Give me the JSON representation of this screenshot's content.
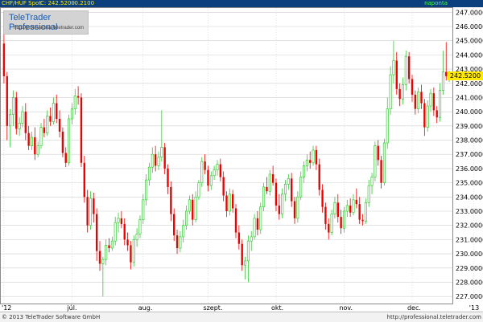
{
  "header": {
    "symbol": "CHF/HUF Spot",
    "price": "C: 242.5200",
    "change": "-0.2100",
    "period": "naponta"
  },
  "logo": {
    "title": "TeleTrader Professional",
    "url": "http://professional.teletrader.com"
  },
  "footer": {
    "copyright": "© 2013 TeleTrader Software GmbH",
    "url": "http://professional.teletrader.com"
  },
  "colors": {
    "up": "#33cc33",
    "down": "#ee0000",
    "grid": "#cfcfcf",
    "header_bg": "#0b3f7d"
  },
  "last_price_label": "242.5200",
  "chart_data": {
    "type": "candlestick",
    "ylim": [
      226.5,
      247.3
    ],
    "y_ticks": [
      "227.0000",
      "228.0000",
      "229.0000",
      "230.0000",
      "231.0000",
      "232.0000",
      "233.0000",
      "234.0000",
      "235.0000",
      "236.0000",
      "237.0000",
      "238.0000",
      "239.0000",
      "240.0000",
      "241.0000",
      "242.0000",
      "243.0000",
      "244.0000",
      "245.0000",
      "246.0000",
      "247.0000"
    ],
    "x_tick_labels": [
      "'12",
      "júl.",
      "aug.",
      "szept.",
      "okt.",
      "nov.",
      "dec.",
      "'13"
    ],
    "x_tick_index": [
      0,
      22,
      45,
      66,
      88,
      110,
      132,
      152
    ],
    "grid": true,
    "candles": [
      [
        244.8,
        246.0,
        242.0,
        242.5
      ],
      [
        242.5,
        242.8,
        238.0,
        239.0
      ],
      [
        239.0,
        240.2,
        237.5,
        239.8
      ],
      [
        239.8,
        241.5,
        239.0,
        241.0
      ],
      [
        241.0,
        241.4,
        238.4,
        238.8
      ],
      [
        238.8,
        239.6,
        238.3,
        239.2
      ],
      [
        239.2,
        240.4,
        238.9,
        240.0
      ],
      [
        240.0,
        240.6,
        238.0,
        238.5
      ],
      [
        238.5,
        239.0,
        237.3,
        237.6
      ],
      [
        237.6,
        238.6,
        237.3,
        238.2
      ],
      [
        238.2,
        238.9,
        236.6,
        237.0
      ],
      [
        237.0,
        237.9,
        236.8,
        237.6
      ],
      [
        237.6,
        239.2,
        237.4,
        238.9
      ],
      [
        238.9,
        239.5,
        238.2,
        238.5
      ],
      [
        238.5,
        240.1,
        238.3,
        239.7
      ],
      [
        239.7,
        240.3,
        239.0,
        239.3
      ],
      [
        239.3,
        241.0,
        239.1,
        240.6
      ],
      [
        240.6,
        241.2,
        239.2,
        239.5
      ],
      [
        239.5,
        240.1,
        238.2,
        238.6
      ],
      [
        238.6,
        238.9,
        236.8,
        237.1
      ],
      [
        237.1,
        237.5,
        236.1,
        236.4
      ],
      [
        236.4,
        239.8,
        236.2,
        239.5
      ],
      [
        239.5,
        240.6,
        239.1,
        240.2
      ],
      [
        240.2,
        241.6,
        239.8,
        241.1
      ],
      [
        241.1,
        241.8,
        240.5,
        241.0
      ],
      [
        241.0,
        241.3,
        236.1,
        236.4
      ],
      [
        236.4,
        236.9,
        233.6,
        234.0
      ],
      [
        234.0,
        234.5,
        231.5,
        232.0
      ],
      [
        232.0,
        234.4,
        231.7,
        233.9
      ],
      [
        233.9,
        234.3,
        232.2,
        232.8
      ],
      [
        232.8,
        233.2,
        229.5,
        230.2
      ],
      [
        230.2,
        230.9,
        228.8,
        229.3
      ],
      [
        229.3,
        229.8,
        227.0,
        229.6
      ],
      [
        229.6,
        231.0,
        229.2,
        230.6
      ],
      [
        230.6,
        231.1,
        230.1,
        230.4
      ],
      [
        230.4,
        231.2,
        230.2,
        230.9
      ],
      [
        230.9,
        232.6,
        230.6,
        232.2
      ],
      [
        232.2,
        232.9,
        231.5,
        232.5
      ],
      [
        232.5,
        233.0,
        231.8,
        232.1
      ],
      [
        232.1,
        232.5,
        230.6,
        231.0
      ],
      [
        231.0,
        231.5,
        230.2,
        230.6
      ],
      [
        230.6,
        230.9,
        228.9,
        229.4
      ],
      [
        229.4,
        231.3,
        229.1,
        231.0
      ],
      [
        231.0,
        231.8,
        230.5,
        231.4
      ],
      [
        231.4,
        232.7,
        231.1,
        232.4
      ],
      [
        232.4,
        234.2,
        232.1,
        233.8
      ],
      [
        233.8,
        235.6,
        233.4,
        235.2
      ],
      [
        235.2,
        236.4,
        234.8,
        236.1
      ],
      [
        236.1,
        237.5,
        235.7,
        237.0
      ],
      [
        237.0,
        237.6,
        235.8,
        236.2
      ],
      [
        236.2,
        237.2,
        235.9,
        236.8
      ],
      [
        236.8,
        240.1,
        236.5,
        237.5
      ],
      [
        237.5,
        237.8,
        235.6,
        236.0
      ],
      [
        236.0,
        236.3,
        234.2,
        234.7
      ],
      [
        234.7,
        235.1,
        232.3,
        232.8
      ],
      [
        232.8,
        233.2,
        230.9,
        231.3
      ],
      [
        231.3,
        231.7,
        230.0,
        230.4
      ],
      [
        230.4,
        231.6,
        230.1,
        231.2
      ],
      [
        231.2,
        232.4,
        230.8,
        232.0
      ],
      [
        232.0,
        233.4,
        231.7,
        233.0
      ],
      [
        233.0,
        234.1,
        232.8,
        233.8
      ],
      [
        233.8,
        234.2,
        232.0,
        232.4
      ],
      [
        232.4,
        234.4,
        232.2,
        234.0
      ],
      [
        234.0,
        235.2,
        233.8,
        235.0
      ],
      [
        235.0,
        236.8,
        234.7,
        236.5
      ],
      [
        236.5,
        237.0,
        235.6,
        235.9
      ],
      [
        235.9,
        236.2,
        234.4,
        234.8
      ],
      [
        234.8,
        235.8,
        234.5,
        235.5
      ],
      [
        235.5,
        236.2,
        235.2,
        235.9
      ],
      [
        235.9,
        236.6,
        235.5,
        236.3
      ],
      [
        236.3,
        236.7,
        235.1,
        235.4
      ],
      [
        235.4,
        235.8,
        233.7,
        234.1
      ],
      [
        234.1,
        234.4,
        232.6,
        233.0
      ],
      [
        233.0,
        234.6,
        232.7,
        234.2
      ],
      [
        234.2,
        234.5,
        232.9,
        233.2
      ],
      [
        233.2,
        233.5,
        231.1,
        231.5
      ],
      [
        231.5,
        232.0,
        230.3,
        230.7
      ],
      [
        230.7,
        231.0,
        228.8,
        229.2
      ],
      [
        229.2,
        229.8,
        228.2,
        229.5
      ],
      [
        229.5,
        231.3,
        228.0,
        230.9
      ],
      [
        230.9,
        231.6,
        230.2,
        231.2
      ],
      [
        231.2,
        232.8,
        231.0,
        232.5
      ],
      [
        232.5,
        233.0,
        231.3,
        231.7
      ],
      [
        231.7,
        233.6,
        231.4,
        233.3
      ],
      [
        233.3,
        235.0,
        233.0,
        234.7
      ],
      [
        234.7,
        235.4,
        234.2,
        234.4
      ],
      [
        234.4,
        235.9,
        234.1,
        235.6
      ],
      [
        235.6,
        236.2,
        234.8,
        235.0
      ],
      [
        235.0,
        235.3,
        233.0,
        233.4
      ],
      [
        233.4,
        234.2,
        232.4,
        232.8
      ],
      [
        232.8,
        234.6,
        232.5,
        234.2
      ],
      [
        234.2,
        235.2,
        233.7,
        234.9
      ],
      [
        234.9,
        235.6,
        234.5,
        235.3
      ],
      [
        235.3,
        235.7,
        233.3,
        233.7
      ],
      [
        233.7,
        234.0,
        232.1,
        232.5
      ],
      [
        232.5,
        234.4,
        232.2,
        234.0
      ],
      [
        234.0,
        235.8,
        233.8,
        235.4
      ],
      [
        235.4,
        236.5,
        235.0,
        236.2
      ],
      [
        236.2,
        237.0,
        235.8,
        236.6
      ],
      [
        236.6,
        237.2,
        236.0,
        236.4
      ],
      [
        236.4,
        237.6,
        236.2,
        237.3
      ],
      [
        237.3,
        237.6,
        235.9,
        236.3
      ],
      [
        236.3,
        236.7,
        234.1,
        234.5
      ],
      [
        234.5,
        234.9,
        232.9,
        233.3
      ],
      [
        233.3,
        233.6,
        231.7,
        232.1
      ],
      [
        232.1,
        232.5,
        231.0,
        231.5
      ],
      [
        231.5,
        233.1,
        231.3,
        232.8
      ],
      [
        232.8,
        234.0,
        232.5,
        233.6
      ],
      [
        233.6,
        234.2,
        232.2,
        232.6
      ],
      [
        232.6,
        233.1,
        231.4,
        231.8
      ],
      [
        231.8,
        233.3,
        231.5,
        233.0
      ],
      [
        233.0,
        233.8,
        232.6,
        233.4
      ],
      [
        233.4,
        233.9,
        232.6,
        232.9
      ],
      [
        232.9,
        234.2,
        232.7,
        233.8
      ],
      [
        233.8,
        234.6,
        233.2,
        233.5
      ],
      [
        233.5,
        234.0,
        232.1,
        232.4
      ],
      [
        232.4,
        232.8,
        232.0,
        232.3
      ],
      [
        232.3,
        233.9,
        232.1,
        233.6
      ],
      [
        233.6,
        235.2,
        233.3,
        234.8
      ],
      [
        234.8,
        235.7,
        234.2,
        235.4
      ],
      [
        235.4,
        237.9,
        235.1,
        237.6
      ],
      [
        237.6,
        238.0,
        236.2,
        236.6
      ],
      [
        236.6,
        236.9,
        234.6,
        235.0
      ],
      [
        235.0,
        238.1,
        234.8,
        237.8
      ],
      [
        237.8,
        241.0,
        237.4,
        240.2
      ],
      [
        240.2,
        243.2,
        239.8,
        242.6
      ],
      [
        242.6,
        245.0,
        242.0,
        243.6
      ],
      [
        243.6,
        244.2,
        241.2,
        241.6
      ],
      [
        241.6,
        242.0,
        240.4,
        240.9
      ],
      [
        240.9,
        242.4,
        240.5,
        241.9
      ],
      [
        241.9,
        244.3,
        241.5,
        243.9
      ],
      [
        243.9,
        244.2,
        242.0,
        242.3
      ],
      [
        242.3,
        242.6,
        240.7,
        241.2
      ],
      [
        241.2,
        241.5,
        239.8,
        240.2
      ],
      [
        240.2,
        241.7,
        239.9,
        241.4
      ],
      [
        241.4,
        241.9,
        240.2,
        240.6
      ],
      [
        240.6,
        240.9,
        238.3,
        238.9
      ],
      [
        238.9,
        240.8,
        238.6,
        240.4
      ],
      [
        240.4,
        241.6,
        240.0,
        241.3
      ],
      [
        241.3,
        241.7,
        239.7,
        240.1
      ],
      [
        240.1,
        240.4,
        239.2,
        239.6
      ],
      [
        239.6,
        242.0,
        239.3,
        241.5
      ],
      [
        241.5,
        244.3,
        241.2,
        242.8
      ],
      [
        242.8,
        244.9,
        242.2,
        242.5
      ],
      [
        242.5,
        242.9,
        242.1,
        242.52
      ]
    ]
  }
}
